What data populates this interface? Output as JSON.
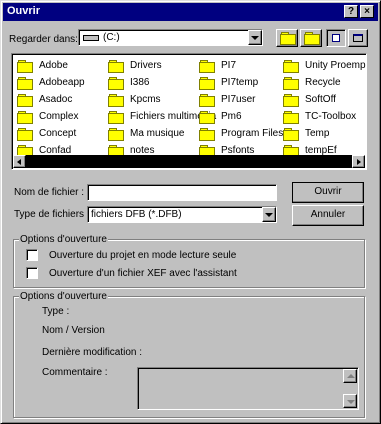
{
  "window": {
    "title": "Ouvrir",
    "help_glyph": "?",
    "close_glyph": "×"
  },
  "lookin": {
    "label": "Regarder dans:",
    "value": "(C:)",
    "up_icon": "up-folder-icon",
    "new_folder_icon": "new-folder-icon",
    "list_view_icon": "list-view-icon",
    "details_view_icon": "details-view-icon"
  },
  "files": {
    "col1": [
      "Adobe",
      "Adobeapp",
      "Asadoc",
      "Complex",
      "Concept",
      "Confad"
    ],
    "col2": [
      "Drivers",
      "I386",
      "Kpcms",
      "Fichiers multimédia",
      "Ma musique",
      "notes"
    ],
    "col3": [
      "PI7",
      "PI7temp",
      "PI7user",
      "Pm6",
      "Program Files",
      "Psfonts"
    ],
    "col4": [
      "Unity Proemp",
      "Recycle",
      "SoftOff",
      "TC-Toolbox",
      "Temp",
      "tempEf"
    ]
  },
  "filename": {
    "label": "Nom de fichier :",
    "value": ""
  },
  "filetype": {
    "label": "Type de fichiers",
    "value": "fichiers DFB (*.DFB)"
  },
  "buttons": {
    "open": "Ouvrir",
    "cancel": "Annuler"
  },
  "options1": {
    "legend": "Options d'ouverture",
    "readonly": "Ouverture du projet en mode lecture seule",
    "xef": "Ouverture d'un fichier XEF avec l'assistant"
  },
  "options2": {
    "legend": "Options d'ouverture",
    "type": "Type :",
    "name_version": "Nom / Version",
    "last_modif": "Dernière modification :",
    "comment": "Commentaire :"
  },
  "colors": {
    "titlebar": "#000080",
    "face": "#c0c0c0",
    "folder": "#ffff00"
  }
}
